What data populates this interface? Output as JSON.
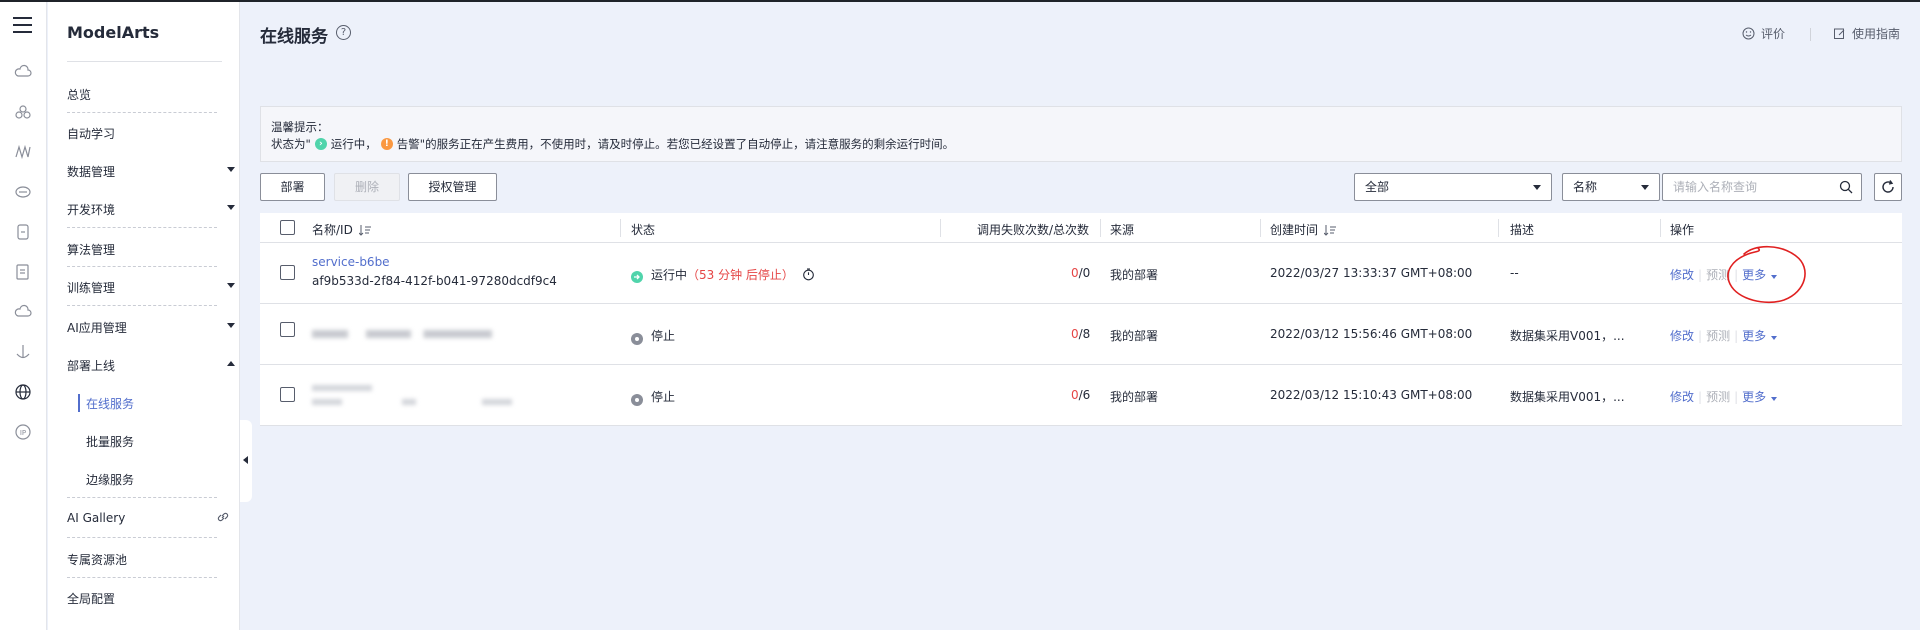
{
  "sidebar": {
    "brand": "ModelArts",
    "items": [
      {
        "label": "总览",
        "has_arrow": false
      },
      {
        "label": "自动学习",
        "has_arrow": false
      },
      {
        "label": "数据管理",
        "has_arrow": true
      },
      {
        "label": "开发环境",
        "has_arrow": true
      },
      {
        "label": "算法管理",
        "has_arrow": false
      },
      {
        "label": "训练管理",
        "has_arrow": true
      },
      {
        "label": "AI应用管理",
        "has_arrow": true
      },
      {
        "label": "部署上线",
        "has_arrow": true,
        "expanded": true
      },
      {
        "label": "AI Gallery",
        "has_arrow": false,
        "link": true
      },
      {
        "label": "专属资源池",
        "has_arrow": false
      },
      {
        "label": "全局配置",
        "has_arrow": false
      }
    ],
    "sub_items": [
      {
        "label": "在线服务",
        "active": true
      },
      {
        "label": "批量服务",
        "active": false
      },
      {
        "label": "边缘服务",
        "active": false
      }
    ]
  },
  "header": {
    "title": "在线服务",
    "help": "?",
    "rate_label": "评价",
    "guide_label": "使用指南"
  },
  "notice": {
    "title": "温馨提示：",
    "text_prefix": "状态为\"",
    "running": "运行中",
    "alarm": "告警",
    "text_suffix": "\"的服务正在产生费用，不使用时，请及时停止。若您已经设置了自动停止，请注意服务的剩余运行时间。"
  },
  "toolbar": {
    "deploy": "部署",
    "delete": "删除",
    "auth": "授权管理",
    "filter_value": "全部",
    "field_value": "名称",
    "search_placeholder": "请输入名称查询"
  },
  "table": {
    "columns": {
      "name": "名称/ID",
      "status": "状态",
      "calls": "调用失败次数/总次数",
      "source": "来源",
      "created": "创建时间",
      "desc": "描述",
      "ops": "操作"
    },
    "rows": [
      {
        "name": "service-b6be",
        "id": "af9b533d-2f84-412f-b041-97280dcdf9c4",
        "status": "运行中",
        "status_extra": "（53 分钟 后停止）",
        "status_color": "#50d4ab",
        "fail": "0",
        "total": "/0",
        "source": "我的部署",
        "created": "2022/03/27 13:33:37 GMT+08:00",
        "desc": "--",
        "op_modify": "修改",
        "op_predict": "预测",
        "op_more": "更多"
      },
      {
        "name": "",
        "id": "",
        "status": "停止",
        "status_extra": "",
        "status_color": "#8a8e99",
        "fail": "0",
        "total": "/8",
        "source": "我的部署",
        "created": "2022/03/12 15:56:46 GMT+08:00",
        "desc": "数据集采用V001，...",
        "op_modify": "修改",
        "op_predict": "预测",
        "op_more": "更多"
      },
      {
        "name": "",
        "id": "",
        "status": "停止",
        "status_extra": "",
        "status_color": "#8a8e99",
        "fail": "0",
        "total": "/6",
        "source": "我的部署",
        "created": "2022/03/12 15:10:43 GMT+08:00",
        "desc": "数据集采用V001，...",
        "op_modify": "修改",
        "op_predict": "预测",
        "op_more": "更多"
      }
    ]
  },
  "colors": {
    "accent": "#526ecc",
    "running": "#50d4ab",
    "alarm": "#fa9841",
    "error": "#e54545",
    "annotation": "#e02020"
  }
}
